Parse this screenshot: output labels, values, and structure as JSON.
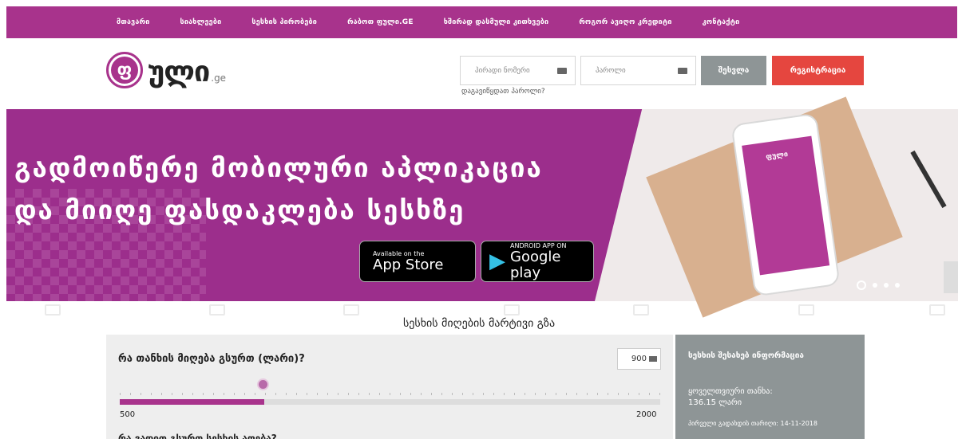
{
  "nav": {
    "items": [
      "მთავარი",
      "სიახლეები",
      "სესხის პირობები",
      "რაბოთ ფული.GE",
      "ხშირად დასმული კითხვები",
      "როგორ ავიღო კრედიტი",
      "კონტაქტი"
    ]
  },
  "logo": {
    "mark": "ფ",
    "text": "ული",
    "tld": ".ge"
  },
  "login": {
    "personal_id_placeholder": "პირადი ნომერი",
    "password_placeholder": "პაროლი",
    "forgot_password": "დაგავიწყდათ პაროლი?",
    "login_button": "შესვლა",
    "register_button": "რეგისტრაცია"
  },
  "banner": {
    "line1": "გადმოიწერე მობილური აპლიკაცია",
    "line2": "და მიიღე ფასდაკლება სესხზე",
    "appstore_small": "Available on the",
    "appstore_big": "App Store",
    "googleplay_small": "ANDROID APP ON",
    "googleplay_big": "Google play",
    "phone_logo": "ფული"
  },
  "main": {
    "tagline": "სესხის მიღების მარტივი გზა",
    "question_amount": "რა თანხის მიღება გსურთ (ლარი)?",
    "amount_value": "900",
    "slider": {
      "min_label": "500",
      "max_label": "2000",
      "value": 900,
      "min": 500,
      "max": 2000
    },
    "question_term": "რა ვადით გსურთ სესხის აღება?"
  },
  "info": {
    "title": "სესხის შესახებ ინფორმაცია",
    "total_label": "ყოველთვიური თანხა:",
    "total_value": "136.15 ლარი",
    "date_text": "პირველი გადახდის თარიღი: 14-11-2018"
  }
}
